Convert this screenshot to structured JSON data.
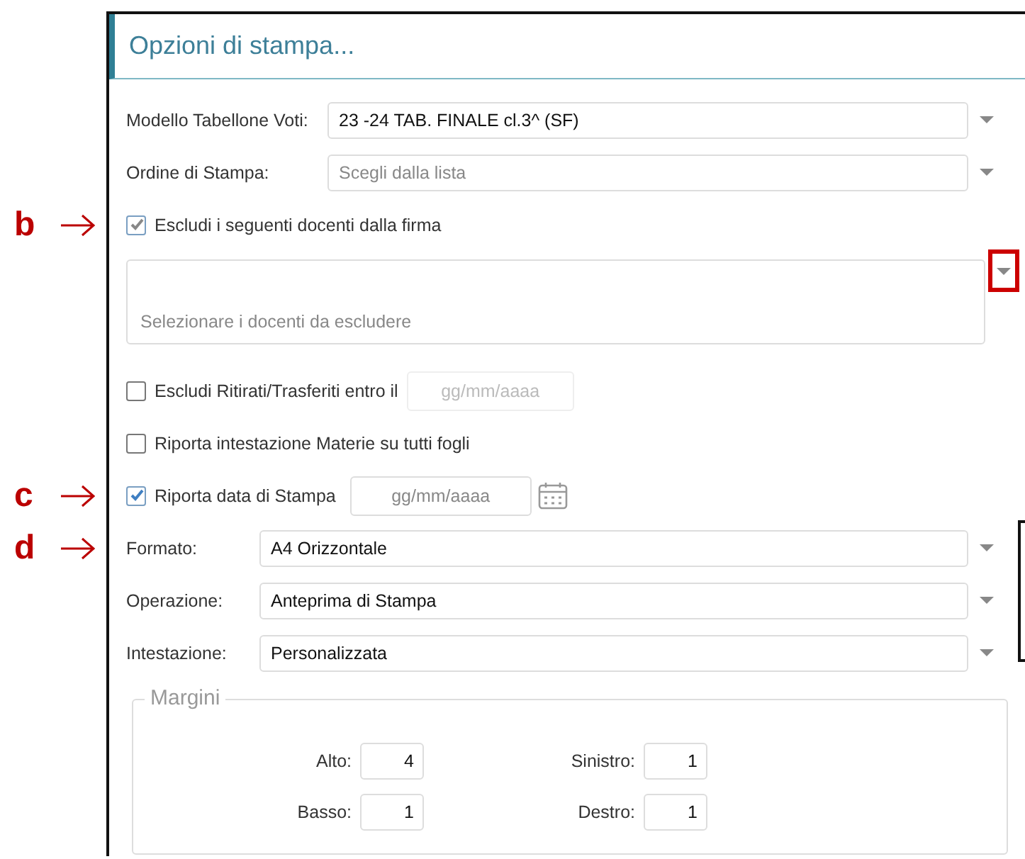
{
  "title": "Opzioni di stampa...",
  "selects": [
    {
      "label": "Modello Tabellone Voti:",
      "value": "23 -24 TAB. FINALE cl.3^ (SF)"
    },
    {
      "label": "Ordine di Stampa:",
      "placeholder": "Scegli dalla lista"
    }
  ],
  "exclude_teachers": {
    "annotation": "b",
    "label": "Escludi i seguenti docenti dalla firma",
    "checked": true,
    "placeholder": "Selezionare i docenti da escludere",
    "caret_highlighted": true
  },
  "exclude_withdrawn": {
    "label": "Escludi Ritirati/Trasferiti entro il",
    "checked": false,
    "date_placeholder": "gg/mm/aaaa"
  },
  "repeat_subjects": {
    "label": "Riporta intestazione Materie su tutti fogli",
    "checked": false
  },
  "print_date": {
    "annotation": "c",
    "label": "Riporta data di Stampa",
    "checked": true,
    "date_placeholder": "gg/mm/aaaa"
  },
  "output_selects": [
    {
      "annotation": "d",
      "label": "Formato:",
      "value": "A4 Orizzontale"
    },
    {
      "label": "Operazione:",
      "value": "Anteprima di Stampa"
    },
    {
      "label": "Intestazione:",
      "value": "Personalizzata"
    }
  ],
  "margins": {
    "legend": "Margini",
    "fields": [
      {
        "label": "Alto:",
        "value": "4"
      },
      {
        "label": "Sinistro:",
        "value": "1"
      },
      {
        "label": "Basso:",
        "value": "1"
      },
      {
        "label": "Destro:",
        "value": "1"
      }
    ]
  }
}
